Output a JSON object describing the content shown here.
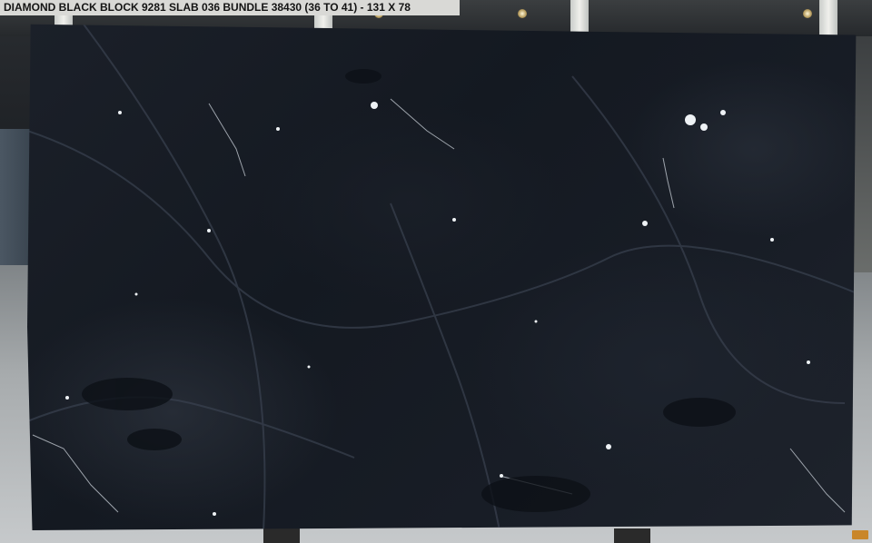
{
  "caption": {
    "text": "DIAMOND BLACK BLOCK 9281 SLAB 036  BUNDLE 38430 (36 TO 41) - 131 X 78"
  },
  "photo": {
    "subject": "black marble slab with white veins in warehouse",
    "slab_color": "#161b23",
    "vein_color": "#e8ecf0"
  }
}
